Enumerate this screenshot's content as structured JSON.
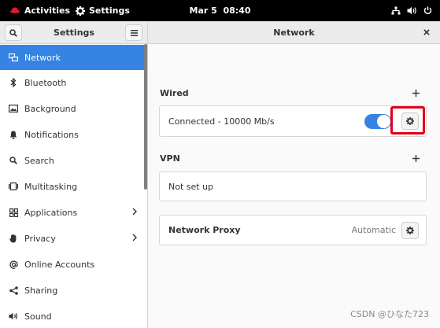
{
  "topbar": {
    "activities_label": "Activities",
    "app_label": "Settings",
    "clock": "Mar 5  08:40",
    "accent": "#e01b24"
  },
  "sidebar": {
    "title": "Settings",
    "items": [
      {
        "label": "Network",
        "icon": "network-icon",
        "active": true
      },
      {
        "label": "Bluetooth",
        "icon": "bluetooth-icon"
      },
      {
        "label": "Background",
        "icon": "background-icon"
      },
      {
        "label": "Notifications",
        "icon": "bell-icon"
      },
      {
        "label": "Search",
        "icon": "search-icon"
      },
      {
        "label": "Multitasking",
        "icon": "multitasking-icon"
      },
      {
        "label": "Applications",
        "icon": "applications-icon",
        "chevron": true
      },
      {
        "label": "Privacy",
        "icon": "hand-icon",
        "chevron": true
      },
      {
        "label": "Online Accounts",
        "icon": "at-icon"
      },
      {
        "label": "Sharing",
        "icon": "share-icon"
      },
      {
        "label": "Sound",
        "icon": "speaker-icon"
      }
    ]
  },
  "main": {
    "title": "Network",
    "wired": {
      "label": "Wired",
      "status": "Connected - 10000 Mb/s",
      "enabled": true
    },
    "vpn": {
      "label": "VPN",
      "status": "Not set up"
    },
    "proxy": {
      "label": "Network Proxy",
      "value": "Automatic"
    }
  },
  "colors": {
    "accent": "#3584e4",
    "highlight": "#e0001a"
  },
  "watermark": "CSDN @ひなた723"
}
